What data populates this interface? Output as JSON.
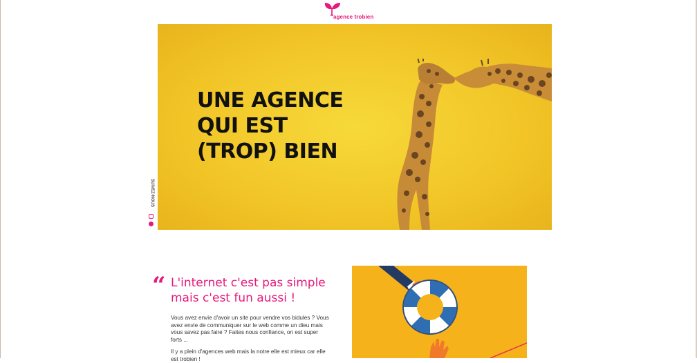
{
  "brand": {
    "logo_text": "agence trobien",
    "color": "#e6197d"
  },
  "hero": {
    "title_lines": [
      "UNE AGENCE",
      "QUI EST",
      "(TROP) BIEN"
    ],
    "background": "#f2c527"
  },
  "social": {
    "label": "SUIVEZ-NOUS",
    "icons": [
      "instagram-icon",
      "youtube-icon"
    ]
  },
  "content": {
    "headline_lines": [
      "L'internet c'est pas simple",
      "mais c'est fun aussi !"
    ],
    "paragraph1": "Vous avez envie d'avoir un site pour vendre vos bidules ? Vous avez envie de communiquer sur le web comme un dieu mais vous savez pas faire ? Faites nous confiance, on est super forts ...",
    "paragraph2": "Il y a plein d'agences web mais la notre elle est mieux car elle est trobien !"
  },
  "promo": {
    "background": "#f6b21b",
    "illustration": "lifebuoy-rescue-illustration"
  }
}
